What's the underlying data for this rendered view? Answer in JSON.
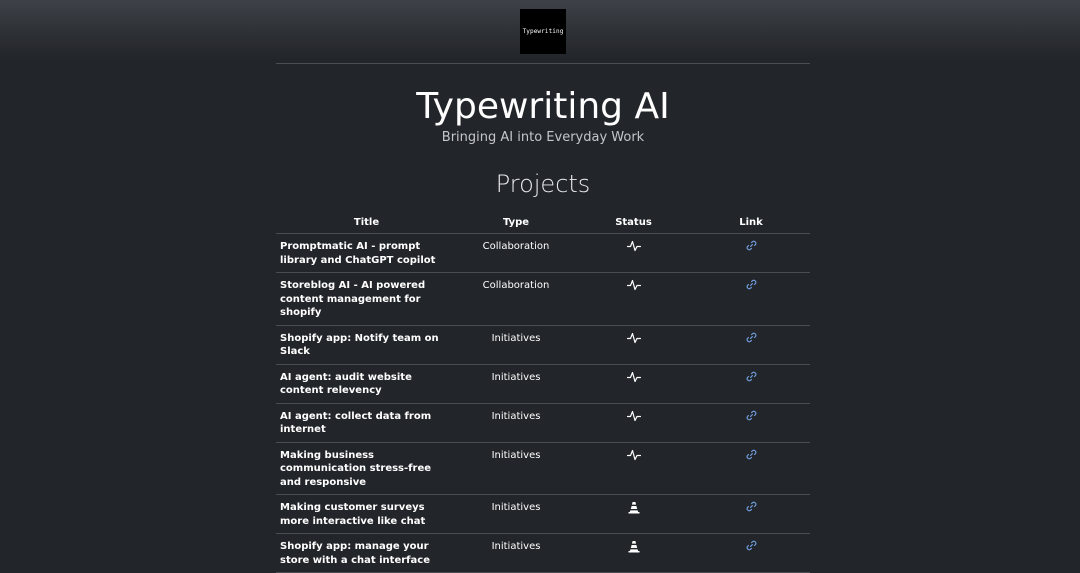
{
  "logo": {
    "text": "Typewriting"
  },
  "header": {
    "title": "Typewriting AI",
    "subtitle": "Bringing AI into Everyday Work"
  },
  "projects": {
    "heading": "Projects",
    "columns": [
      "Title",
      "Type",
      "Status",
      "Link"
    ],
    "rows": [
      {
        "title": "Promptmatic AI - prompt library and ChatGPT copilot",
        "type": "Collaboration",
        "status_icon": "activity-icon",
        "link_icon": "link-icon"
      },
      {
        "title": "Storeblog AI - AI powered content management for shopify",
        "type": "Collaboration",
        "status_icon": "activity-icon",
        "link_icon": "link-icon"
      },
      {
        "title": "Shopify app: Notify team on Slack",
        "type": "Initiatives",
        "status_icon": "activity-icon",
        "link_icon": "link-icon"
      },
      {
        "title": "AI agent: audit website content relevency",
        "type": "Initiatives",
        "status_icon": "activity-icon",
        "link_icon": "link-icon"
      },
      {
        "title": "AI agent: collect data from internet",
        "type": "Initiatives",
        "status_icon": "activity-icon",
        "link_icon": "link-icon"
      },
      {
        "title": "Making business communication stress-free and responsive",
        "type": "Initiatives",
        "status_icon": "activity-icon",
        "link_icon": "link-icon"
      },
      {
        "title": "Making customer surveys more interactive like chat",
        "type": "Initiatives",
        "status_icon": "traffic-cone-icon",
        "link_icon": "link-icon"
      },
      {
        "title": "Shopify app: manage your store with a chat interface",
        "type": "Initiatives",
        "status_icon": "traffic-cone-icon",
        "link_icon": "link-icon"
      }
    ]
  },
  "colors": {
    "background": "#22252a",
    "link": "#6f9ad8",
    "divider": "#4a4d52"
  }
}
